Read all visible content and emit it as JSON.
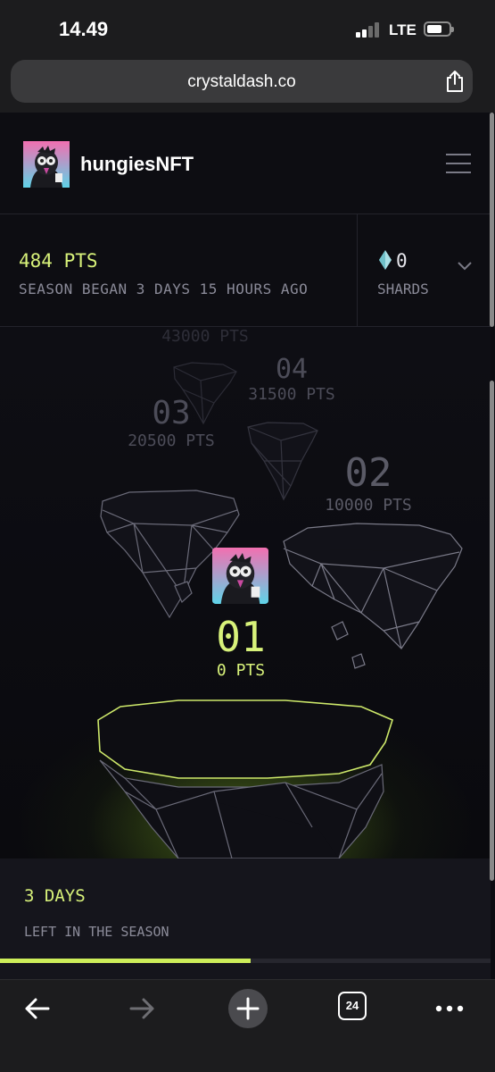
{
  "status_bar": {
    "time": "14.49",
    "network": "LTE"
  },
  "browser": {
    "url": "crystaldash.co",
    "tab_count": "24"
  },
  "header": {
    "username": "hungiesNFT"
  },
  "stats": {
    "points": "484 PTS",
    "season_text": "SEASON BEGAN 3 DAYS 15 HOURS AGO",
    "shards_count": "0",
    "shards_label": "SHARDS"
  },
  "levels": [
    {
      "num": "01",
      "pts": "0 PTS",
      "state": "current"
    },
    {
      "num": "02",
      "pts": "10000 PTS",
      "state": "locked"
    },
    {
      "num": "03",
      "pts": "20500 PTS",
      "state": "locked"
    },
    {
      "num": "04",
      "pts": "31500 PTS",
      "state": "locked"
    },
    {
      "num": "",
      "pts": "43000 PTS",
      "state": "locked"
    }
  ],
  "season": {
    "days": "3 DAYS",
    "label": "LEFT IN THE SEASON",
    "progress_fraction": 0.51
  },
  "colors": {
    "accent": "#d8f27a",
    "muted": "#8b8b99",
    "background": "#0c0c11"
  },
  "icons": [
    "share-icon",
    "menu-icon",
    "shard-icon",
    "chevron-down-icon",
    "back-icon",
    "forward-icon",
    "plus-icon",
    "tabs-icon",
    "more-icon"
  ]
}
